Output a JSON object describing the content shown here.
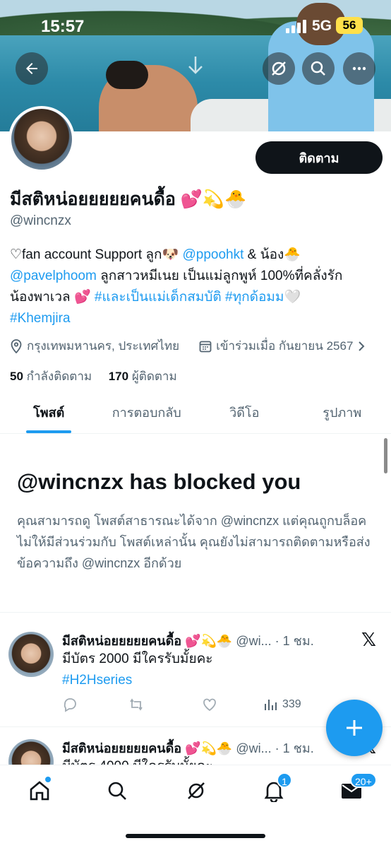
{
  "status_bar": {
    "time": "15:57",
    "network": "5G",
    "battery": "56"
  },
  "profile": {
    "display_name": "มีสติหน่อยยยยยคนดื้อ 💕💫🐣",
    "handle": "@wincnzx",
    "follow_label": "ติดตาม",
    "bio": {
      "line1_a": "♡fan account Support ลูก🐶 ",
      "mention1": "@ppoohkt",
      "line1_b": " & น้อง🐣",
      "mention2": "@pavelphoom",
      "line2_b": " ลูกสาวหมีเนย เป็นแม่ลูกพูห์ 100%ที่คลั่งรัก",
      "line3_a": "น้องพาเวล 💕 ",
      "hashtag1": "#และเป็นแม่เด็กสมบัติ",
      "hashtag2": "#ทุกด้อมม",
      "line3_b": "🤍",
      "hashtag3": "#Khemjira"
    },
    "location": "กรุงเทพมหานคร, ประเทศไทย",
    "joined": "เข้าร่วมเมื่อ กันยายน 2567",
    "following_count": "50",
    "following_label": "กำลังติดตาม",
    "followers_count": "170",
    "followers_label": "ผู้ติดตาม"
  },
  "tabs": [
    "โพสต์",
    "การตอบกลับ",
    "วิดีโอ",
    "รูปภาพ"
  ],
  "blocked": {
    "title": "@wincnzx has blocked you",
    "text": "คุณสามารถดู โพสต์สาธารณะได้จาก @wincnzx แต่คุณถูกบล็อคไม่ให้มีส่วนร่วมกับ โพสต์เหล่านั้น คุณยังไม่สามารถติดตามหรือส่งข้อความถึง @wincnzx อีกด้วย"
  },
  "posts": [
    {
      "name": "มีสติหน่อยยยยยคนดื้อ 💕💫🐣",
      "handle_time": "@wi... · 1 ชม.",
      "text": "มีบัตร 2000 มีใครรับมั้ยคะ",
      "hashtag": "#H2Hseries",
      "views": "339"
    },
    {
      "name": "มีสติหน่อยยยยยคนดื้อ 💕💫🐣",
      "handle_time": "@wi... · 1 ชม.",
      "text": "มีบัตร 4000 มีใครรับมั้ยคะ"
    }
  ],
  "nav": {
    "notifications_badge": "1",
    "messages_badge": "20+"
  },
  "colors": {
    "accent": "#1d9bf0",
    "text": "#0f1419",
    "muted": "#536471"
  }
}
